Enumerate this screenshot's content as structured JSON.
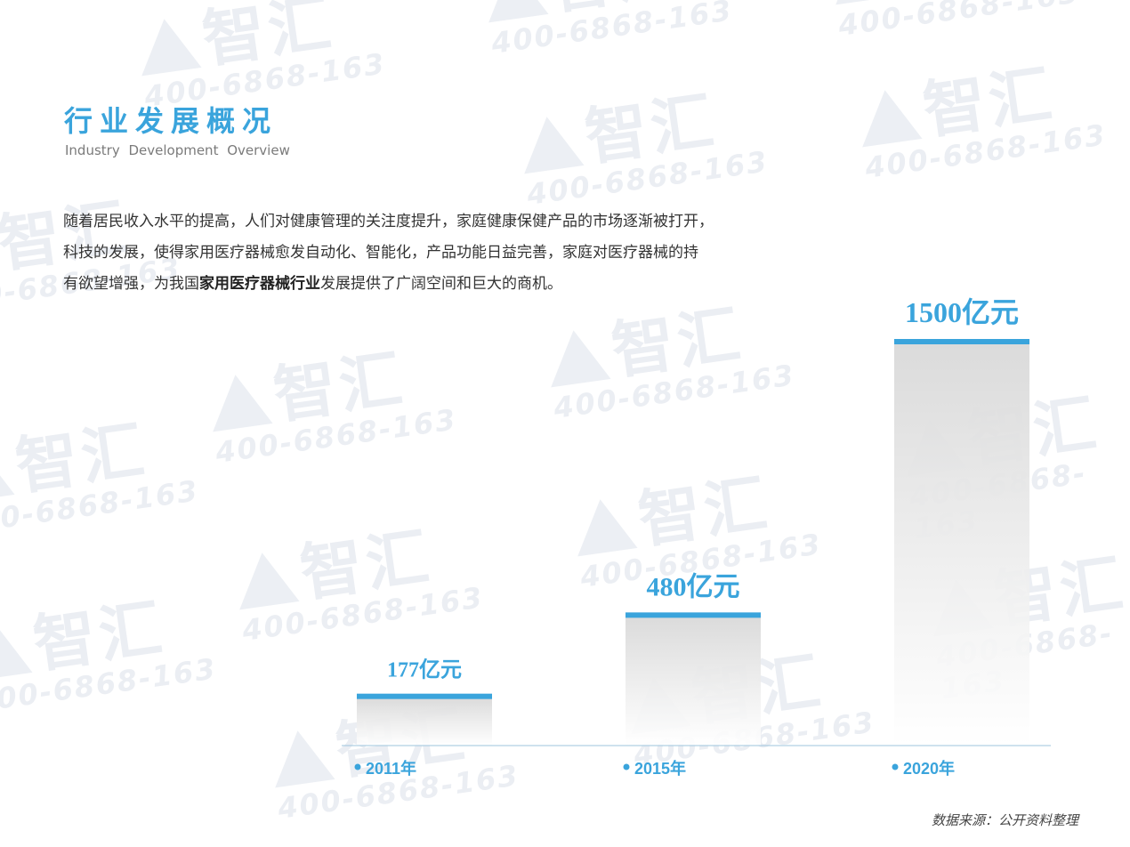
{
  "header": {
    "title": "行业发展概况",
    "subtitle": "Industry Development Overview"
  },
  "intro": {
    "line1": "随着居民收入水平的提高，人们对健康管理的关注度提升，家庭健康保健产品的市场逐渐被打开，",
    "line2": "科技的发展，使得家用医疗器械愈发自动化、智能化，产品功能日益完善，家庭对医疗器械的持",
    "line3_before": "有欲望增强，为我国",
    "line3_bold": "家用医疗器械行业",
    "line3_after": "发展提供了广阔空间和巨大的商机。"
  },
  "watermark": {
    "brand": "智汇",
    "phone": "400-6868-163"
  },
  "colors": {
    "accent": "#3aa4dc",
    "bar_top": "#d9d9d9",
    "bar_bottom": "#ffffff",
    "axis": "#9cc4dc"
  },
  "chart_data": {
    "type": "bar",
    "categories": [
      "2011年",
      "2015年",
      "2020年"
    ],
    "values": [
      177,
      480,
      1500
    ],
    "value_labels": [
      "177亿元",
      "480亿元",
      "1500亿元"
    ],
    "unit": "亿元",
    "ylim": [
      0,
      1500
    ],
    "grid": false
  },
  "footer": {
    "source": "数据来源：公开资料整理"
  }
}
